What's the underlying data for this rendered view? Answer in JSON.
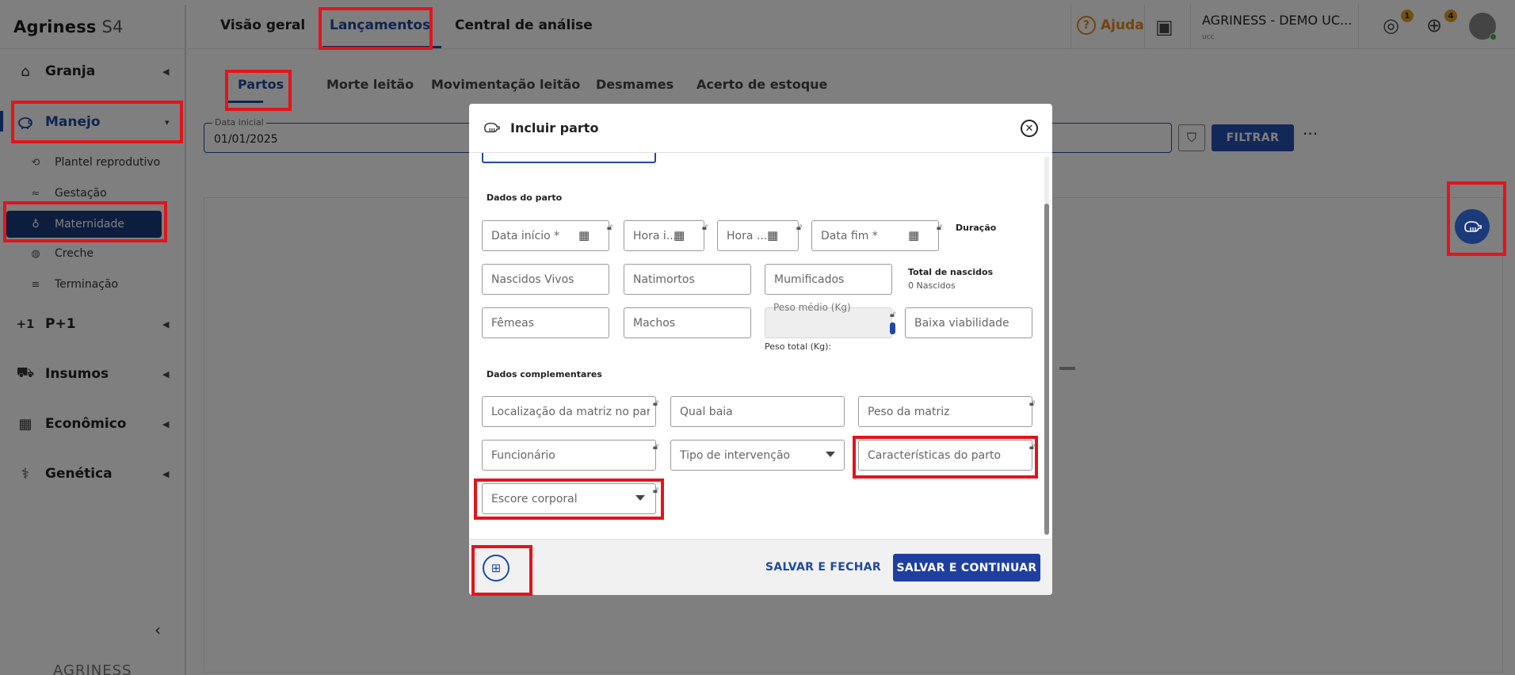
{
  "app": {
    "brand_bold": "Agriness",
    "brand_light": " S4",
    "footer_logo": "AGRINESS"
  },
  "sidebar": {
    "items": [
      {
        "label": "Granja",
        "icon": "home-icon"
      },
      {
        "label": "Manejo",
        "icon": "pig-icon"
      },
      {
        "label": "P+1",
        "icon": "plus-one-icon"
      },
      {
        "label": "Insumos",
        "icon": "forklift-icon"
      },
      {
        "label": "Econômico",
        "icon": "calculator-icon"
      },
      {
        "label": "Genética",
        "icon": "dna-icon"
      }
    ],
    "subitems": [
      {
        "label": "Plantel reprodutivo",
        "icon": "sow-icon"
      },
      {
        "label": "Gestação",
        "icon": "gestation-icon"
      },
      {
        "label": "Maternidade",
        "icon": "bottle-icon"
      },
      {
        "label": "Creche",
        "icon": "piglet-icon"
      },
      {
        "label": "Terminação",
        "icon": "barn-icon"
      }
    ]
  },
  "topbar": {
    "tabs": [
      "Visão geral",
      "Lançamentos",
      "Central de análise"
    ],
    "help": "Ajuda",
    "company": "AGRINESS - DEMO UC...",
    "company_sub": "ucc",
    "badge_notifications": "1",
    "badge_downloads": "4"
  },
  "content": {
    "subtabs": [
      "Partos",
      "Morte leitão",
      "Movimentação leitão",
      "Desmames",
      "Acerto de estoque"
    ],
    "date_label": "Data inicial",
    "date_value": "01/01/2025",
    "filter_label": "FILTRAR",
    "more": "···"
  },
  "modal": {
    "title": "Incluir parto",
    "section_parto": "Dados do parto",
    "section_complementares": "Dados complementares",
    "fields": {
      "data_inicio": "Data início *",
      "hora_inicio": "Hora i...",
      "hora_fim": "Hora ...",
      "data_fim": "Data fim *",
      "nascidos_vivos": "Nascidos Vivos",
      "natimortos": "Natimortos",
      "mumificados": "Mumificados",
      "femeas": "Fêmeas",
      "machos": "Machos",
      "peso_medio": "Peso médio (Kg)",
      "baixa_viabilidade": "Baixa viabilidade",
      "localizacao": "Localização da matriz no par...",
      "qual_baia": "Qual baia",
      "peso_matriz": "Peso da matriz",
      "funcionario": "Funcionário",
      "tipo_intervencao": "Tipo de intervenção",
      "caracteristicas": "Características do parto",
      "escore_corporal": "Escore corporal"
    },
    "duracao": "Duração",
    "total_nascidos_title": "Total de nascidos",
    "total_nascidos_value": "0 Nascidos",
    "peso_total": "Peso total (Kg):",
    "btn_salvar_fechar": "SALVAR E FECHAR",
    "btn_salvar_continuar": "SALVAR E CONTINUAR"
  },
  "colors": {
    "primary": "#1f4aa0",
    "sidebar_selected": "#1a3a7a",
    "help_orange": "#e08a1e",
    "highlight_red": "#e3141a"
  }
}
